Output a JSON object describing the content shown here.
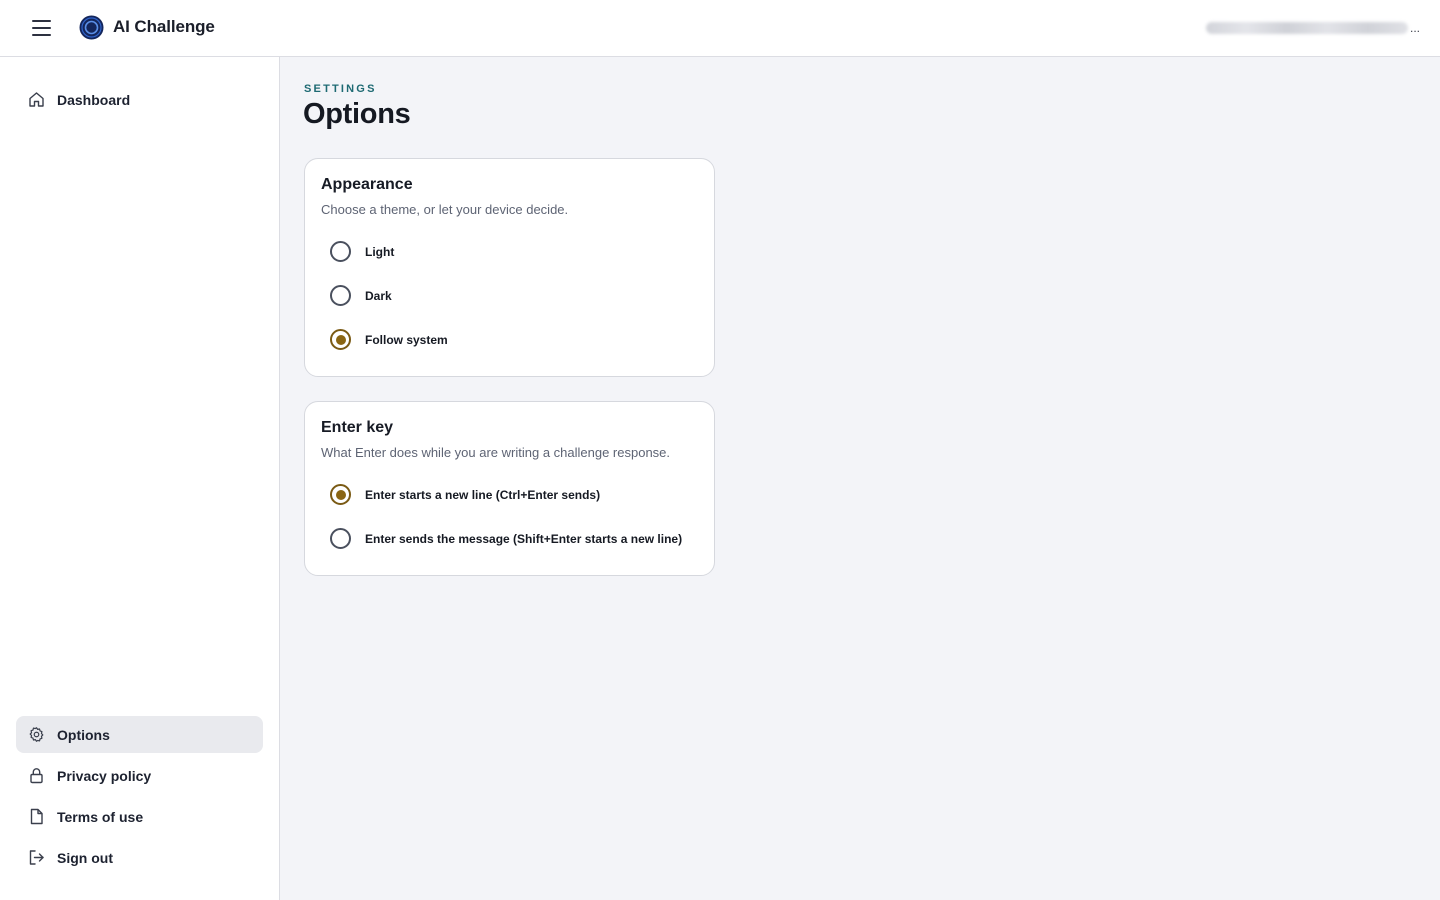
{
  "header": {
    "app_title": "AI Challenge",
    "menu_icon": "hamburger-menu-icon",
    "logo_icon": "circle-logo-icon",
    "user_email_suffix": "...",
    "accent_color": "#1c3a7a"
  },
  "sidebar": {
    "top_items": [
      {
        "label": "Dashboard",
        "icon": "home-icon"
      }
    ],
    "bottom_items": [
      {
        "label": "Options",
        "icon": "gear-icon",
        "active": true
      },
      {
        "label": "Privacy policy",
        "icon": "lock-icon"
      },
      {
        "label": "Terms of use",
        "icon": "document-icon"
      },
      {
        "label": "Sign out",
        "icon": "sign-out-icon"
      }
    ],
    "active_bg": "#e9eaee"
  },
  "main": {
    "eyebrow": "SETTINGS",
    "title": "Options",
    "appearance": {
      "title": "Appearance",
      "description": "Choose a theme, or let your device decide.",
      "options": [
        {
          "label": "Light",
          "checked": false
        },
        {
          "label": "Dark",
          "checked": false
        },
        {
          "label": "Follow system",
          "checked": true
        }
      ]
    },
    "enter_key": {
      "title": "Enter key",
      "description": "What Enter does while you are writing a challenge response.",
      "options": [
        {
          "label": "Enter starts a new line (Ctrl+Enter sends)",
          "checked": true
        },
        {
          "label": "Enter sends the message (Shift+Enter starts a new line)",
          "checked": false
        }
      ]
    },
    "radio_checked_color": "#8a6513",
    "eyebrow_color": "#1e6a73"
  }
}
